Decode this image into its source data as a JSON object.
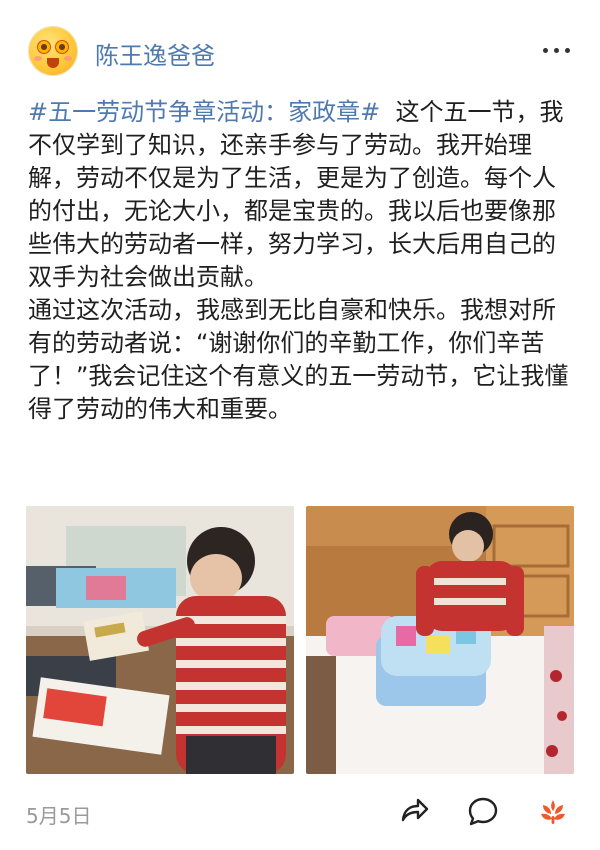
{
  "user": {
    "name": "陈王逸爸爸"
  },
  "post": {
    "hashtag": "#五一劳动节争章活动：家政章#",
    "paragraph1_rest": "这个五一节，我不仅学到了知识，还亲手参与了劳动。我开始理解，劳动不仅是为了生活，更是为了创造。每个人的付出，无论大小，都是宝贵的。我以后也要像那些伟大的劳动者一样，努力学习，长大后用自己的双手为社会做出贡献。",
    "paragraph2": "通过这次活动，我感到无比自豪和快乐。我想对所有的劳动者说：“谢谢你们的辛勤工作，你们辛苦了！”我会记住这个有意义的五一劳动节，它让我懂得了劳动的伟大和重要。"
  },
  "footer": {
    "date": "5月5日"
  },
  "icons": {
    "more": "more-dots-icon",
    "share": "share-icon",
    "comment": "comment-icon",
    "like": "flower-like-icon"
  },
  "colors": {
    "link": "#4f7ab0",
    "like": "#f05a28",
    "date": "#9a9a9a"
  }
}
